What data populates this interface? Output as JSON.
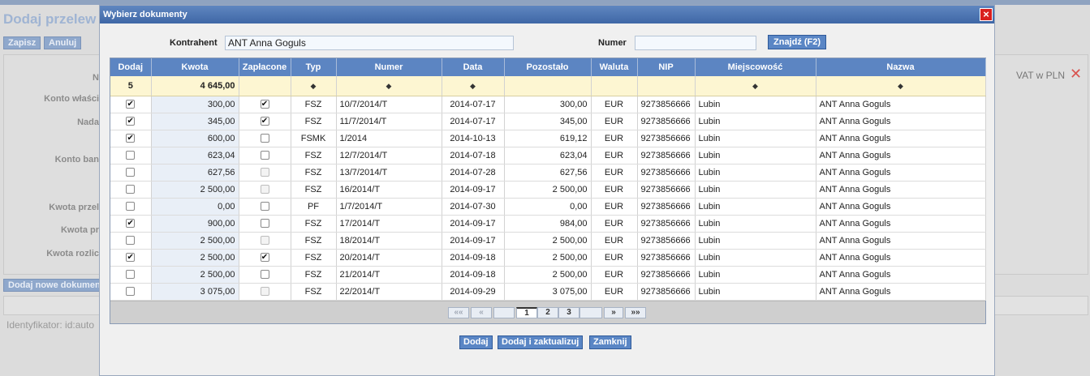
{
  "background": {
    "title": "Dodaj przelew",
    "buttons": {
      "save": "Zapisz",
      "cancel": "Anuluj"
    },
    "labels": [
      "N",
      "Konto właści",
      "Nada",
      "Konto ban",
      "Kwota przel",
      "Kwota pr",
      "Kwota rozlic"
    ],
    "vat_label": "VAT w PLN",
    "add_documents_button": "Dodaj nowe dokumen",
    "identifier": "Identyfikator: id:auto"
  },
  "modal": {
    "title": "Wybierz dokumenty",
    "close_icon": "close-icon",
    "search": {
      "contractor_label": "Kontrahent",
      "contractor_value": "ANT Anna Goguls",
      "number_label": "Numer",
      "number_value": "",
      "find_button": "Znajdź (F2)"
    },
    "table": {
      "headers": [
        "Dodaj",
        "Kwota",
        "Zapłacone",
        "Typ",
        "Numer",
        "Data",
        "Pozostało",
        "Waluta",
        "NIP",
        "Miejscowość",
        "Nazwa"
      ],
      "summary": {
        "count": "5",
        "total": "4 645,00"
      },
      "rows": [
        {
          "add": true,
          "amount": "300,00",
          "paid": true,
          "paid_enabled": true,
          "type": "FSZ",
          "number": "10/7/2014/T",
          "date": "2014-07-17",
          "remaining": "300,00",
          "currency": "EUR",
          "nip": "9273856666",
          "city": "Lubin",
          "name": "ANT Anna Goguls"
        },
        {
          "add": true,
          "amount": "345,00",
          "paid": true,
          "paid_enabled": true,
          "type": "FSZ",
          "number": "11/7/2014/T",
          "date": "2014-07-17",
          "remaining": "345,00",
          "currency": "EUR",
          "nip": "9273856666",
          "city": "Lubin",
          "name": "ANT Anna Goguls"
        },
        {
          "add": true,
          "amount": "600,00",
          "paid": false,
          "paid_enabled": true,
          "type": "FSMK",
          "number": "1/2014",
          "date": "2014-10-13",
          "remaining": "619,12",
          "currency": "EUR",
          "nip": "9273856666",
          "city": "Lubin",
          "name": "ANT Anna Goguls"
        },
        {
          "add": false,
          "amount": "623,04",
          "paid": false,
          "paid_enabled": true,
          "type": "FSZ",
          "number": "12/7/2014/T",
          "date": "2014-07-18",
          "remaining": "623,04",
          "currency": "EUR",
          "nip": "9273856666",
          "city": "Lubin",
          "name": "ANT Anna Goguls"
        },
        {
          "add": false,
          "amount": "627,56",
          "paid": false,
          "paid_enabled": false,
          "type": "FSZ",
          "number": "13/7/2014/T",
          "date": "2014-07-28",
          "remaining": "627,56",
          "currency": "EUR",
          "nip": "9273856666",
          "city": "Lubin",
          "name": "ANT Anna Goguls"
        },
        {
          "add": false,
          "amount": "2 500,00",
          "paid": false,
          "paid_enabled": false,
          "type": "FSZ",
          "number": "16/2014/T",
          "date": "2014-09-17",
          "remaining": "2 500,00",
          "currency": "EUR",
          "nip": "9273856666",
          "city": "Lubin",
          "name": "ANT Anna Goguls"
        },
        {
          "add": false,
          "amount": "0,00",
          "paid": false,
          "paid_enabled": true,
          "type": "PF",
          "number": "1/7/2014/T",
          "date": "2014-07-30",
          "remaining": "0,00",
          "currency": "EUR",
          "nip": "9273856666",
          "city": "Lubin",
          "name": "ANT Anna Goguls"
        },
        {
          "add": true,
          "amount": "900,00",
          "paid": false,
          "paid_enabled": true,
          "type": "FSZ",
          "number": "17/2014/T",
          "date": "2014-09-17",
          "remaining": "984,00",
          "currency": "EUR",
          "nip": "9273856666",
          "city": "Lubin",
          "name": "ANT Anna Goguls"
        },
        {
          "add": false,
          "amount": "2 500,00",
          "paid": false,
          "paid_enabled": false,
          "type": "FSZ",
          "number": "18/2014/T",
          "date": "2014-09-17",
          "remaining": "2 500,00",
          "currency": "EUR",
          "nip": "9273856666",
          "city": "Lubin",
          "name": "ANT Anna Goguls"
        },
        {
          "add": true,
          "amount": "2 500,00",
          "paid": true,
          "paid_enabled": true,
          "type": "FSZ",
          "number": "20/2014/T",
          "date": "2014-09-18",
          "remaining": "2 500,00",
          "currency": "EUR",
          "nip": "9273856666",
          "city": "Lubin",
          "name": "ANT Anna Goguls"
        },
        {
          "add": false,
          "amount": "2 500,00",
          "paid": false,
          "paid_enabled": true,
          "type": "FSZ",
          "number": "21/2014/T",
          "date": "2014-09-18",
          "remaining": "2 500,00",
          "currency": "EUR",
          "nip": "9273856666",
          "city": "Lubin",
          "name": "ANT Anna Goguls"
        },
        {
          "add": false,
          "amount": "3 075,00",
          "paid": false,
          "paid_enabled": false,
          "type": "FSZ",
          "number": "22/2014/T",
          "date": "2014-09-29",
          "remaining": "3 075,00",
          "currency": "EUR",
          "nip": "9273856666",
          "city": "Lubin",
          "name": "ANT Anna Goguls"
        }
      ]
    },
    "pager": {
      "first": "««",
      "prev": "«",
      "pages": [
        "1",
        "2",
        "3"
      ],
      "current_page": "1",
      "next": "»",
      "last": "»»"
    },
    "footer": {
      "add": "Dodaj",
      "add_update": "Dodaj i zaktualizuj",
      "close": "Zamknij"
    }
  },
  "colors": {
    "header": "#5c85c2",
    "filter_row": "#fdf6d2",
    "close": "#d9201f"
  }
}
